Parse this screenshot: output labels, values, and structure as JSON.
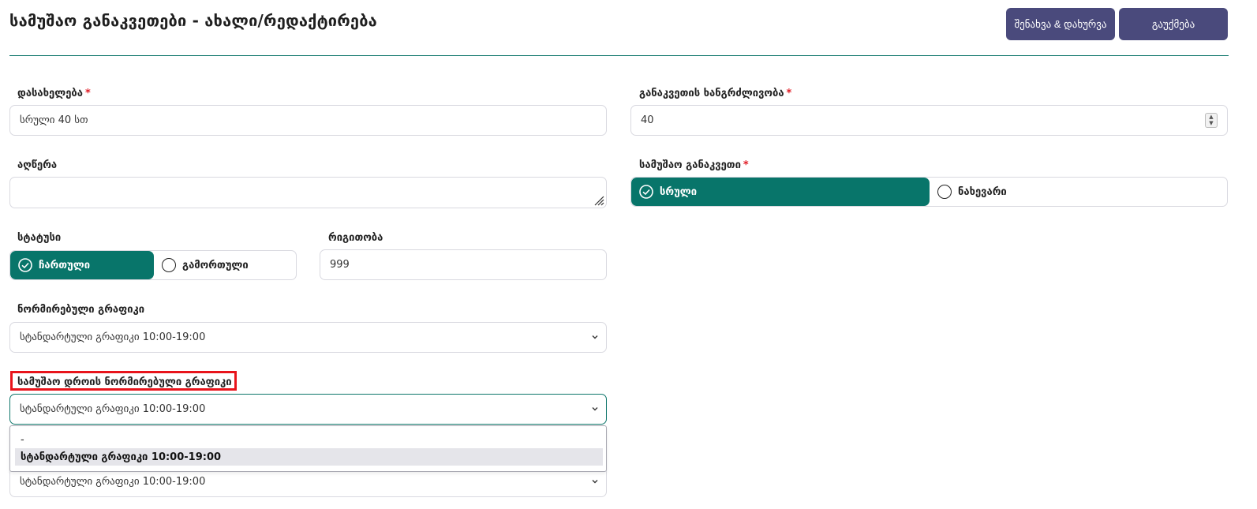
{
  "header": {
    "title": "სამუშაო განაკვეთები - ახალი/რედაქტირება",
    "save_close_label": "შენახვა & დახურვა",
    "cancel_label": "გაუქმება"
  },
  "form": {
    "name": {
      "label": "დასახელება",
      "required_mark": "*",
      "value": "სრული 40 სთ"
    },
    "duration": {
      "label": "განაკვეთის ხანგრძლივობა",
      "required_mark": "*",
      "value": "40"
    },
    "description": {
      "label": "აღწერა",
      "value": ""
    },
    "work_rate": {
      "label": "სამუშაო განაკვეთი",
      "required_mark": "*",
      "options": [
        "სრული",
        "ნახევარი"
      ],
      "selected": "სრული"
    },
    "status": {
      "label": "სტატუსი",
      "options": [
        "ჩართული",
        "გამორთული"
      ],
      "selected": "ჩართული"
    },
    "order": {
      "label": "რიგითობა",
      "value": "999"
    },
    "normalized_schedule": {
      "label": "ნორმირებული გრაფიკი",
      "value": "სტანდარტული გრაფიკი 10:00-19:00"
    },
    "work_time_schedule": {
      "label": "სამუშაო დროის ნორმირებული გრაფიკი",
      "value": "სტანდარტული გრაფიკი 10:00-19:00",
      "dropdown_options": [
        "-",
        "სტანდარტული გრაფიკი 10:00-19:00"
      ],
      "highlighted_option": "სტანდარტული გრაფიკი 10:00-19:00"
    },
    "extra_schedule": {
      "value": "სტანდარტული გრაფიკი 10:00-19:00"
    }
  },
  "colors": {
    "accent": "#08756a",
    "button": "#4a4a7c",
    "required": "#e01b24",
    "highlight_box": "#e8141b"
  },
  "icons": {
    "check": "check-circle-icon",
    "radio": "radio-empty-icon",
    "chevron": "chevron-down-icon",
    "spinner": "number-spinner-icon",
    "resize": "resize-grip-icon"
  }
}
